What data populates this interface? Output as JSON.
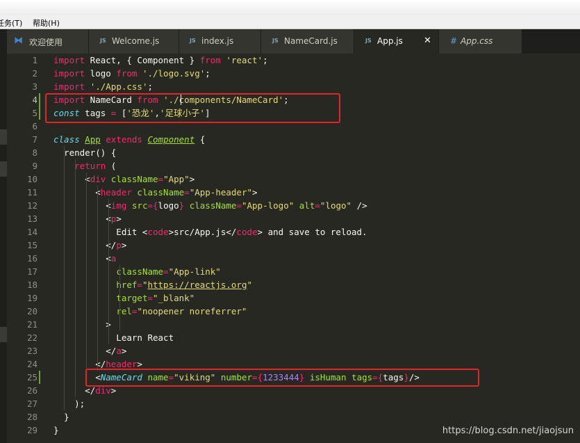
{
  "menu": [
    {
      "label": "任务(T)"
    },
    {
      "label": "帮助(H)"
    }
  ],
  "tabs": [
    {
      "label": "欢迎使用",
      "icon": "vscode-icon",
      "active": false
    },
    {
      "label": "Welcome.js",
      "icon": "js-file-icon",
      "active": false
    },
    {
      "label": "index.js",
      "icon": "js-file-icon",
      "active": false
    },
    {
      "label": "NameCard.js",
      "icon": "js-file-icon",
      "active": false
    },
    {
      "label": "App.js",
      "icon": "js-file-icon",
      "active": true
    },
    {
      "label": "App.css",
      "icon": "css-file-icon",
      "active": false
    }
  ],
  "icons": {
    "js": "JS",
    "css": "#",
    "close": "✕",
    "vscode": "⧓"
  },
  "editor": {
    "cursor_line": 4,
    "lines": [
      [
        [
          "import",
          "kw"
        ],
        [
          " React, { Component } ",
          "p"
        ],
        [
          "from",
          "kw"
        ],
        [
          " ",
          "p"
        ],
        [
          "'react'",
          "str"
        ],
        [
          ";",
          "p"
        ]
      ],
      [
        [
          "import",
          "kw"
        ],
        [
          " logo ",
          "p"
        ],
        [
          "from",
          "kw"
        ],
        [
          " ",
          "p"
        ],
        [
          "'./logo.svg'",
          "str"
        ],
        [
          ";",
          "p"
        ]
      ],
      [
        [
          "import",
          "kw"
        ],
        [
          " ",
          "p"
        ],
        [
          "'./App.css'",
          "str"
        ],
        [
          ";",
          "p"
        ]
      ],
      [
        [
          "import",
          "kw"
        ],
        [
          " NameCard ",
          "p"
        ],
        [
          "from",
          "kw"
        ],
        [
          " ",
          "p"
        ],
        [
          "'./components/NameCard'",
          "str"
        ],
        [
          ";",
          "p"
        ]
      ],
      [
        [
          "const",
          "store"
        ],
        [
          " tags ",
          "p"
        ],
        [
          "=",
          "kw"
        ],
        [
          " [",
          "p"
        ],
        [
          "'恐龙'",
          "str"
        ],
        [
          ",",
          "p"
        ],
        [
          "'足球小子'",
          "str"
        ],
        [
          "]",
          "p"
        ]
      ],
      [],
      [
        [
          "class",
          "store"
        ],
        [
          " ",
          "p"
        ],
        [
          "App",
          "clsname"
        ],
        [
          " ",
          "p"
        ],
        [
          "extends",
          "kw"
        ],
        [
          " ",
          "p"
        ],
        [
          "Component",
          "cls"
        ],
        [
          " {",
          "p"
        ]
      ],
      [
        [
          "  render() {",
          "p"
        ]
      ],
      [
        [
          "    ",
          "p"
        ],
        [
          "return",
          "kw"
        ],
        [
          " (",
          "p"
        ]
      ],
      [
        [
          "      <",
          "p"
        ],
        [
          "div",
          "tag"
        ],
        [
          " ",
          "p"
        ],
        [
          "className",
          "attr"
        ],
        [
          "=",
          "kw"
        ],
        [
          "\"App\"",
          "str"
        ],
        [
          ">",
          "p"
        ]
      ],
      [
        [
          "        <",
          "p"
        ],
        [
          "header",
          "tag"
        ],
        [
          " ",
          "p"
        ],
        [
          "className",
          "attr"
        ],
        [
          "=",
          "kw"
        ],
        [
          "\"App-header\"",
          "str"
        ],
        [
          ">",
          "p"
        ]
      ],
      [
        [
          "          <",
          "p"
        ],
        [
          "img",
          "tag"
        ],
        [
          " ",
          "p"
        ],
        [
          "src",
          "attr"
        ],
        [
          "=",
          "kw"
        ],
        [
          "{",
          "kw"
        ],
        [
          "logo",
          "p"
        ],
        [
          "}",
          "kw"
        ],
        [
          " ",
          "p"
        ],
        [
          "className",
          "attr"
        ],
        [
          "=",
          "kw"
        ],
        [
          "\"App-logo\"",
          "str"
        ],
        [
          " ",
          "p"
        ],
        [
          "alt",
          "attr"
        ],
        [
          "=",
          "kw"
        ],
        [
          "\"logo\"",
          "str"
        ],
        [
          " />",
          "p"
        ]
      ],
      [
        [
          "          <",
          "p"
        ],
        [
          "p",
          "tag"
        ],
        [
          ">",
          "p"
        ]
      ],
      [
        [
          "            Edit <",
          "p"
        ],
        [
          "code",
          "tag"
        ],
        [
          ">src/App.js</",
          "p"
        ],
        [
          "code",
          "tag"
        ],
        [
          "> and save to reload.",
          "p"
        ]
      ],
      [
        [
          "          </",
          "p"
        ],
        [
          "p",
          "tag"
        ],
        [
          ">",
          "p"
        ]
      ],
      [
        [
          "          <",
          "p"
        ],
        [
          "a",
          "tag"
        ]
      ],
      [
        [
          "            ",
          "p"
        ],
        [
          "className",
          "attr"
        ],
        [
          "=",
          "kw"
        ],
        [
          "\"App-link\"",
          "str"
        ]
      ],
      [
        [
          "            ",
          "p"
        ],
        [
          "href",
          "attr"
        ],
        [
          "=",
          "kw"
        ],
        [
          "\"",
          "str"
        ],
        [
          "https://reactjs.org",
          "url"
        ],
        [
          "\"",
          "str"
        ]
      ],
      [
        [
          "            ",
          "p"
        ],
        [
          "target",
          "attr"
        ],
        [
          "=",
          "kw"
        ],
        [
          "\"_blank\"",
          "str"
        ]
      ],
      [
        [
          "            ",
          "p"
        ],
        [
          "rel",
          "attr"
        ],
        [
          "=",
          "kw"
        ],
        [
          "\"noopener noreferrer\"",
          "str"
        ]
      ],
      [
        [
          "          >",
          "p"
        ]
      ],
      [
        [
          "            Learn React",
          "p"
        ]
      ],
      [
        [
          "          </",
          "p"
        ],
        [
          "a",
          "tag"
        ],
        [
          ">",
          "p"
        ]
      ],
      [
        [
          "        </",
          "p"
        ],
        [
          "header",
          "tag"
        ],
        [
          ">",
          "p"
        ]
      ],
      [
        [
          "        <",
          "p"
        ],
        [
          "NameCard",
          "cmp"
        ],
        [
          " ",
          "p"
        ],
        [
          "name",
          "attr"
        ],
        [
          "=",
          "kw"
        ],
        [
          "\"viking\"",
          "str"
        ],
        [
          " ",
          "p"
        ],
        [
          "number",
          "attr"
        ],
        [
          "=",
          "kw"
        ],
        [
          "{",
          "kw"
        ],
        [
          "1233444",
          "num"
        ],
        [
          "}",
          "kw"
        ],
        [
          " ",
          "p"
        ],
        [
          "isHuman",
          "attr"
        ],
        [
          " ",
          "p"
        ],
        [
          "tags",
          "attr"
        ],
        [
          "=",
          "kw"
        ],
        [
          "{",
          "kw"
        ],
        [
          "tags",
          "p"
        ],
        [
          "}",
          "kw"
        ],
        [
          "/>",
          "p"
        ]
      ],
      [
        [
          "      </",
          "p"
        ],
        [
          "div",
          "tag"
        ],
        [
          ">",
          "p"
        ]
      ],
      [
        [
          "    );",
          "p"
        ]
      ],
      [
        [
          "  }",
          "p"
        ]
      ],
      [
        [
          "}",
          "p"
        ]
      ]
    ]
  },
  "watermark": "https://blog.csdn.net/jiaojsun"
}
